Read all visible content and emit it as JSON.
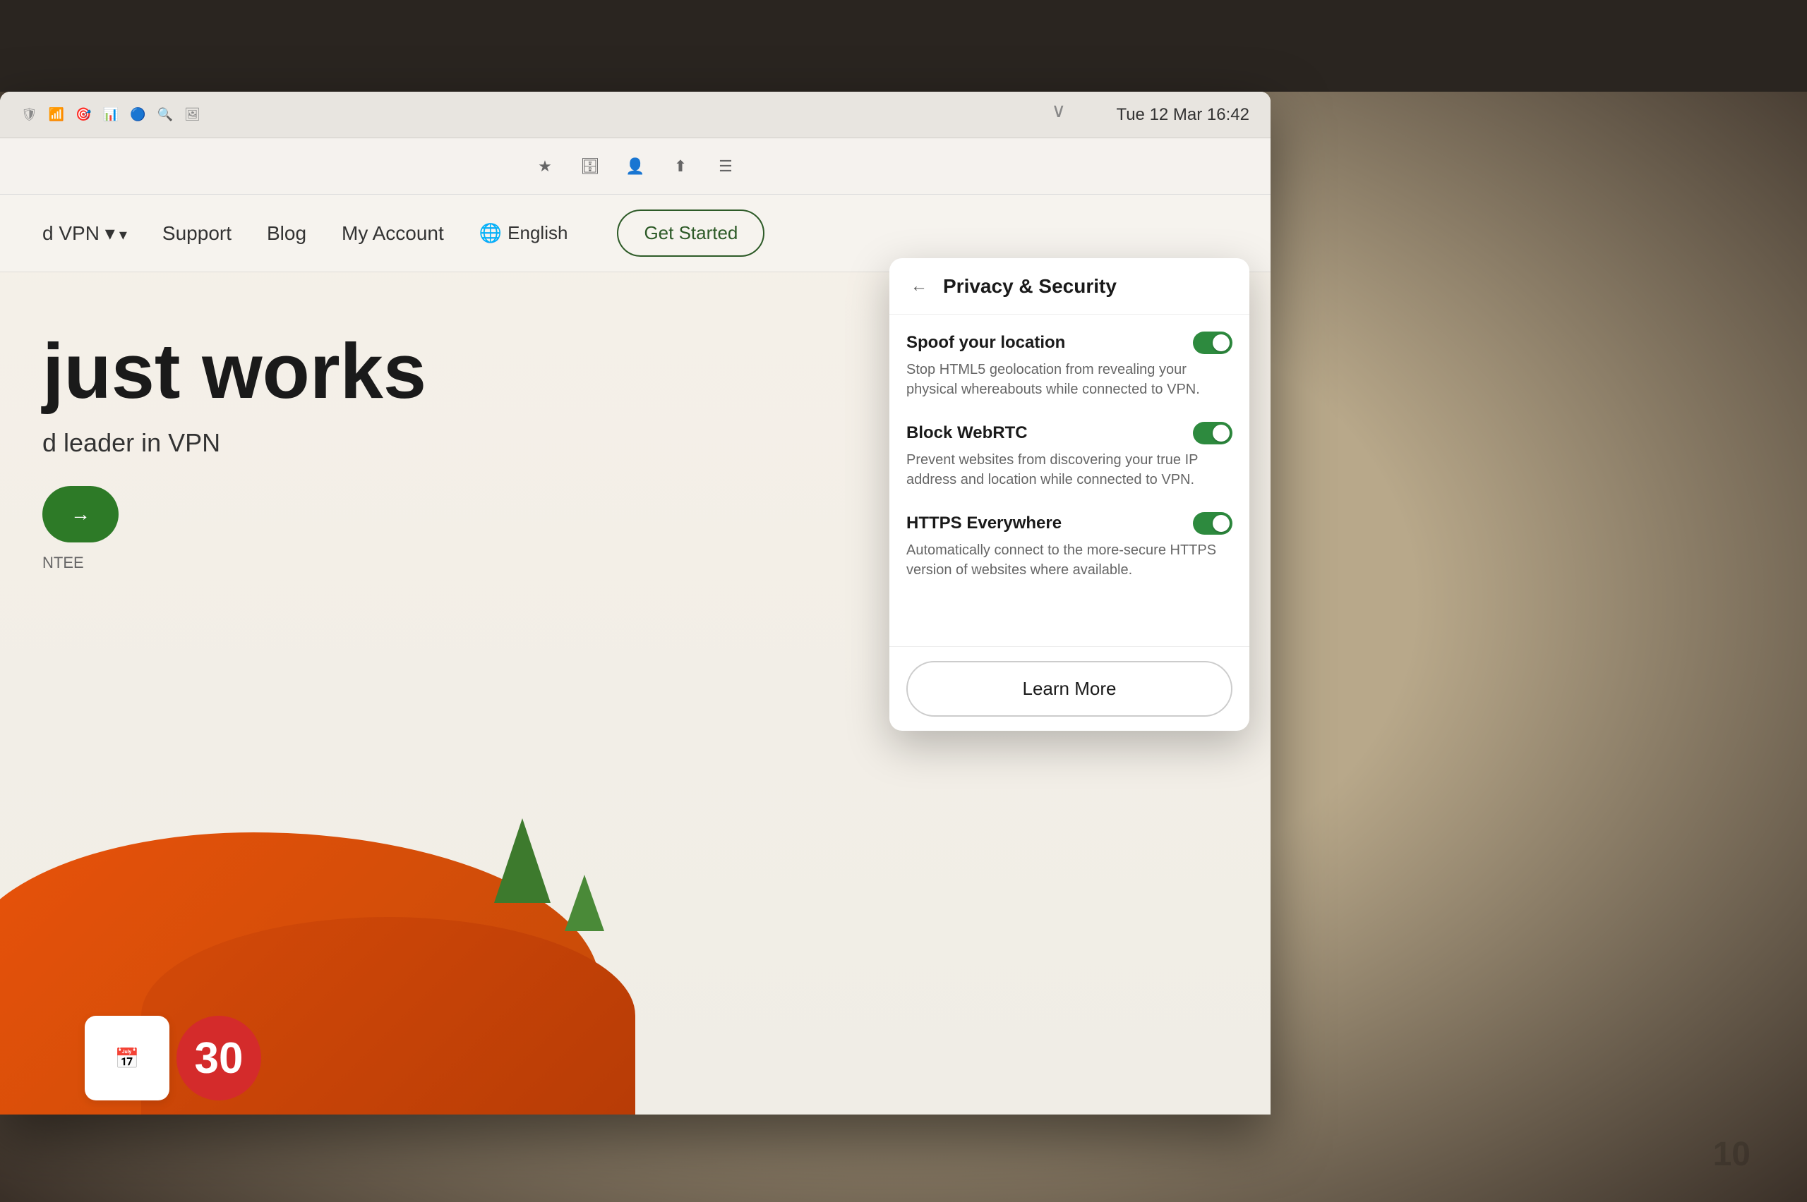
{
  "system": {
    "datetime": "Tue 12 Mar  16:42",
    "icons": [
      "🛡",
      "📶",
      "🎯",
      "📊",
      "⬛",
      "🔵",
      "🔍",
      "🖼"
    ]
  },
  "browser": {
    "toolbar_icons": [
      "★",
      "🗄",
      "👤",
      "⬆",
      "☰"
    ],
    "collapse_arrow": "∨"
  },
  "vpn_site": {
    "nav": {
      "vpn_link": "d VPN ▾",
      "support": "Support",
      "blog": "Blog",
      "my_account": "My Account",
      "lang_icon": "🌐",
      "language": "English",
      "get_started": "Get Started"
    },
    "hero": {
      "title_line1": "just works",
      "subtitle": "d leader in VPN",
      "cta": "→",
      "guarantee": "NTEE"
    },
    "calendar": {
      "number": "30"
    }
  },
  "privacy_panel": {
    "title": "Privacy & Security",
    "back_icon": "←",
    "settings": [
      {
        "name": "Spoof your location",
        "description": "Stop HTML5 geolocation from revealing your physical whereabouts while connected to VPN.",
        "enabled": true
      },
      {
        "name": "Block WebRTC",
        "description": "Prevent websites from discovering your true IP address and location while connected to VPN.",
        "enabled": true
      },
      {
        "name": "HTTPS Everywhere",
        "description": "Automatically connect to the more-secure HTTPS version of websites where available.",
        "enabled": true
      }
    ],
    "learn_more_label": "Learn More"
  },
  "watermark": {
    "text": "10"
  }
}
